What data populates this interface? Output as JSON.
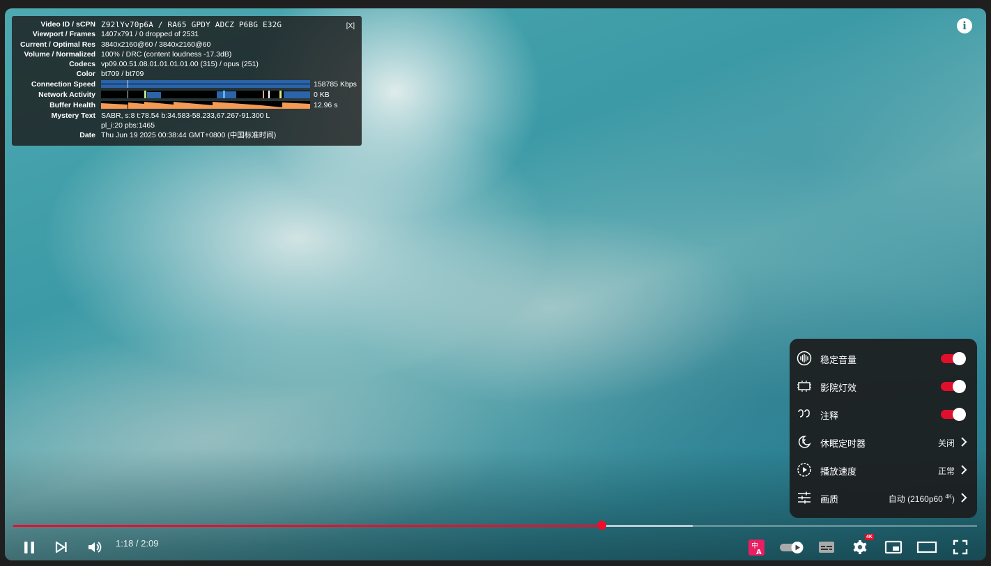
{
  "stats": {
    "close": "[X]",
    "rows": [
      {
        "label": "Video ID / sCPN",
        "value": "Z92lYv70p6A / RA65 GPDY ADCZ P6BG E32G"
      },
      {
        "label": "Viewport / Frames",
        "value": "1407x791 / 0 dropped of 2531"
      },
      {
        "label": "Current / Optimal Res",
        "value": "3840x2160@60 / 3840x2160@60"
      },
      {
        "label": "Volume / Normalized",
        "value": "100% / DRC (content loudness -17.3dB)"
      },
      {
        "label": "Codecs",
        "value": "vp09.00.51.08.01.01.01.01.00 (315) / opus (251)"
      },
      {
        "label": "Color",
        "value": "bt709 / bt709"
      },
      {
        "label": "Connection Speed",
        "value": "158785 Kbps"
      },
      {
        "label": "Network Activity",
        "value": "0 KB"
      },
      {
        "label": "Buffer Health",
        "value": "12.96 s"
      },
      {
        "label": "Mystery Text",
        "value": "SABR, s:8 t:78.54 b:34.583-58.233,67.267-91.300 L"
      },
      {
        "label": "",
        "value": "pl_i:20 pbs:1465"
      },
      {
        "label": "Date",
        "value": "Thu Jun 19 2025 00:38:44 GMT+0800 (中国标准时间)"
      }
    ]
  },
  "info_icon": "i",
  "menu": {
    "items": [
      {
        "label": "稳定音量",
        "toggle": true
      },
      {
        "label": "影院灯效",
        "toggle": true
      },
      {
        "label": "注释",
        "toggle": true
      },
      {
        "label": "休眠定时器",
        "value": "关闭"
      },
      {
        "label": "播放速度",
        "value": "正常"
      },
      {
        "label": "画质",
        "value": "自动 (2160p60",
        "value_sup": "4K",
        "value_end": ")"
      }
    ]
  },
  "player": {
    "time": "1:18 / 2:09",
    "progress_played": 0.61,
    "progress_buffered": 0.705,
    "settings_badge": "4K",
    "colors": {
      "accent": "#ee0d2a",
      "translate_icon_bg": "#e91e63"
    }
  }
}
